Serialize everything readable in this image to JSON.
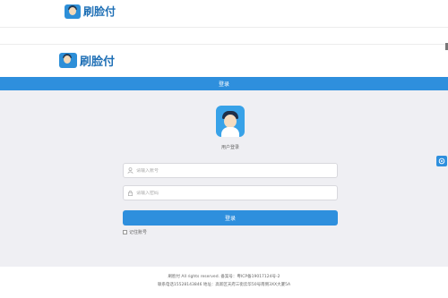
{
  "header": {
    "brand_name_top": "刷脸付",
    "brand_name_main": "刷脸付"
  },
  "login": {
    "title": "登录",
    "user_label": "用户登录",
    "account_placeholder": "请输入账号",
    "password_placeholder": "请输入密码",
    "submit_label": "登录",
    "remember_label": "记住账号"
  },
  "footer": {
    "line1": "刷脸付 All rights reserved. 备案号：粤ICP备19017124号-2",
    "line2": "联系电话15528143846 地址：高新区天府三街云华50号南侧3XX大厦5A"
  },
  "icons": {
    "user_field": "user-icon",
    "password_field": "lock-icon",
    "float": "service-icon"
  },
  "colors": {
    "accent": "#2e8fdd",
    "brand_text": "#1e6fb5",
    "panel_bg": "#efeff3"
  }
}
